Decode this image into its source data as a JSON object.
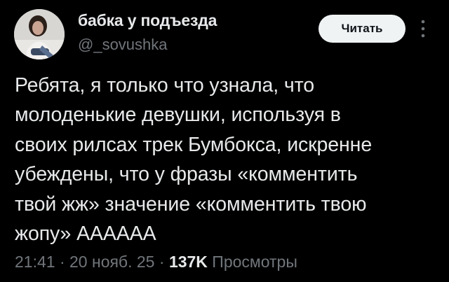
{
  "author": {
    "display_name": "бабка у подъезда",
    "handle": "@_sovushka"
  },
  "follow_button_label": "Читать",
  "tweet": {
    "lines": [
      "Ребята, я только что узнала, что",
      "молоденькие девушки, используя в",
      "своих рилсах трек Бумбокса, искренне",
      "убеждены, что у фразы «комментить",
      "твой жж» значение «комментить твою",
      "жопу» АААААА"
    ]
  },
  "meta": {
    "time": "21:41",
    "separator1": " · ",
    "date": "20 нояб. 25",
    "separator2": " · ",
    "views_count": "137K",
    "views_label": " Просмотры"
  },
  "icons": {
    "more": "more-vertical-icon"
  },
  "colors": {
    "background": "#000000",
    "text": "#e7e9ea",
    "secondary": "#71767b",
    "button_bg": "#eff3f4",
    "button_text": "#0f1419"
  }
}
